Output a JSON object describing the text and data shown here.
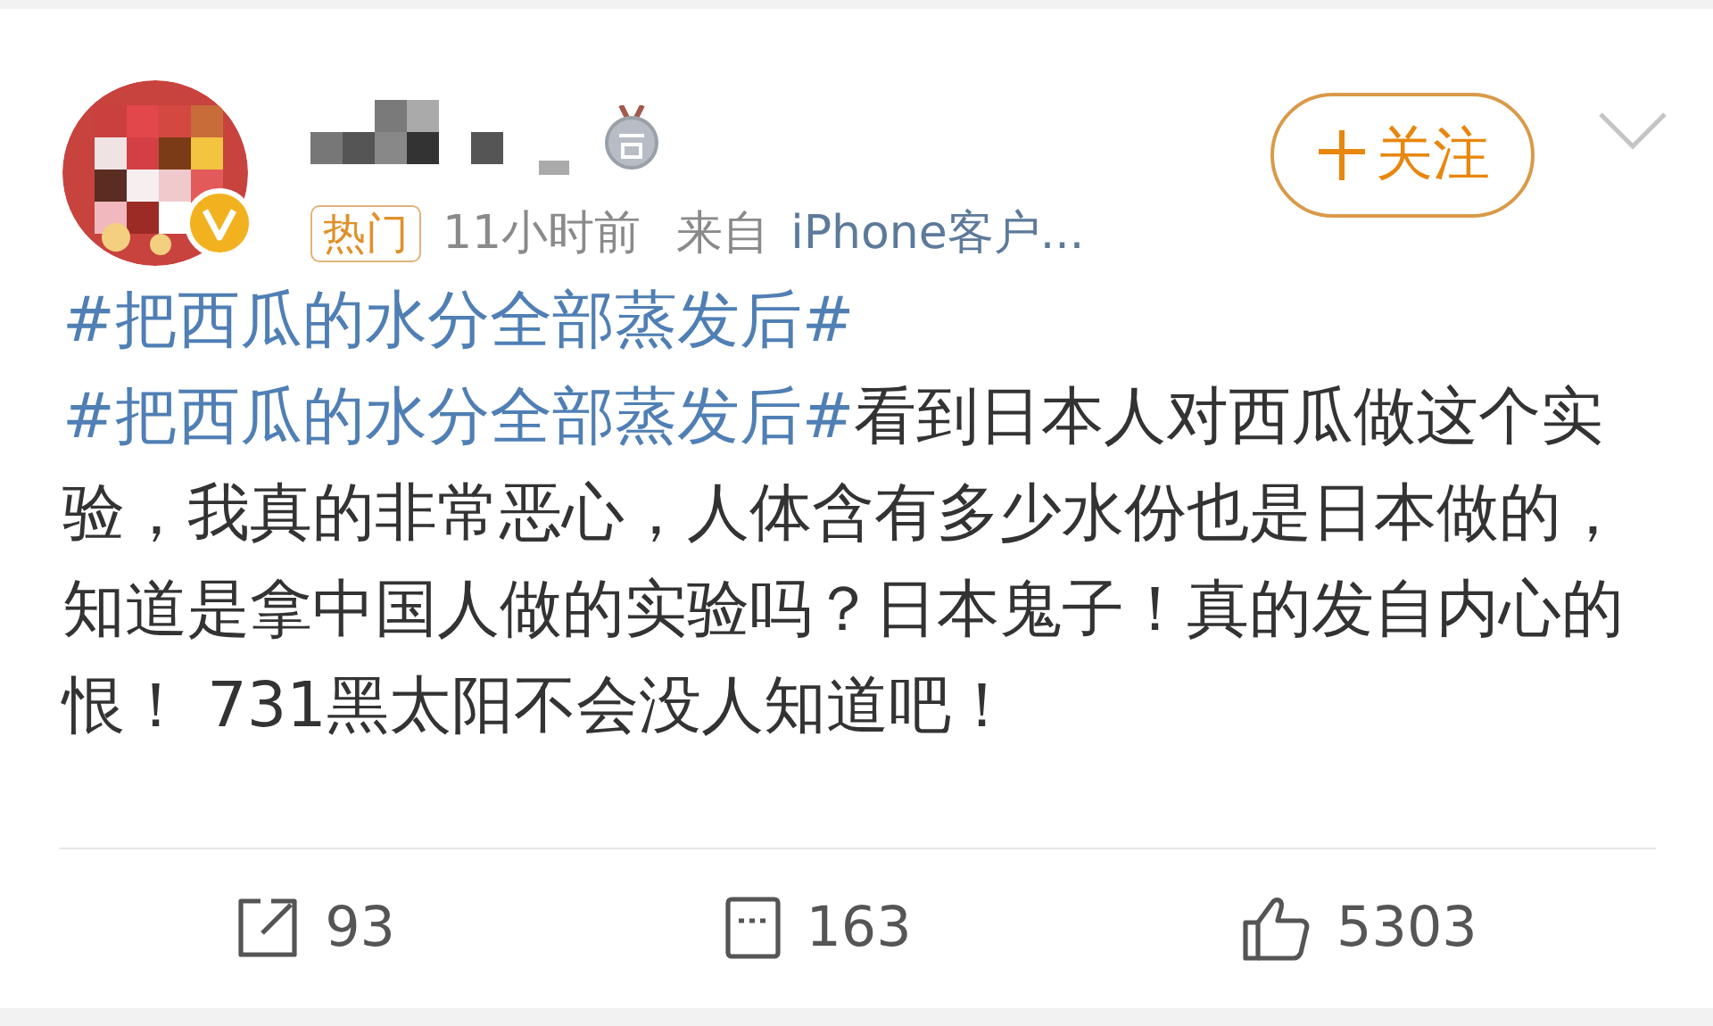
{
  "post": {
    "author": {
      "verified": true,
      "medal": true
    },
    "meta": {
      "tag": "热门",
      "time": "11小时前",
      "source_prefix": "来自",
      "source": "iPhone客户..."
    },
    "follow_button": {
      "label": "关注"
    },
    "content": [
      {
        "kind": "hashtag",
        "text": "#把西瓜的水分全部蒸发后#"
      },
      {
        "kind": "hashtag",
        "text": "#把西瓜的水分全部蒸发后#"
      },
      {
        "kind": "text",
        "text": "看到日本人对西瓜做这个实验，我真的非常恶心，人体含有多少水份也是日本做的，知道是拿中国人做的实验吗？日本鬼子！真的发自内心的恨！ 731黑太阳不会没人知道吧！"
      }
    ],
    "actions": [
      {
        "kind": "repost",
        "count": "93"
      },
      {
        "kind": "comment",
        "count": "163"
      },
      {
        "kind": "like",
        "count": "5303"
      }
    ]
  }
}
